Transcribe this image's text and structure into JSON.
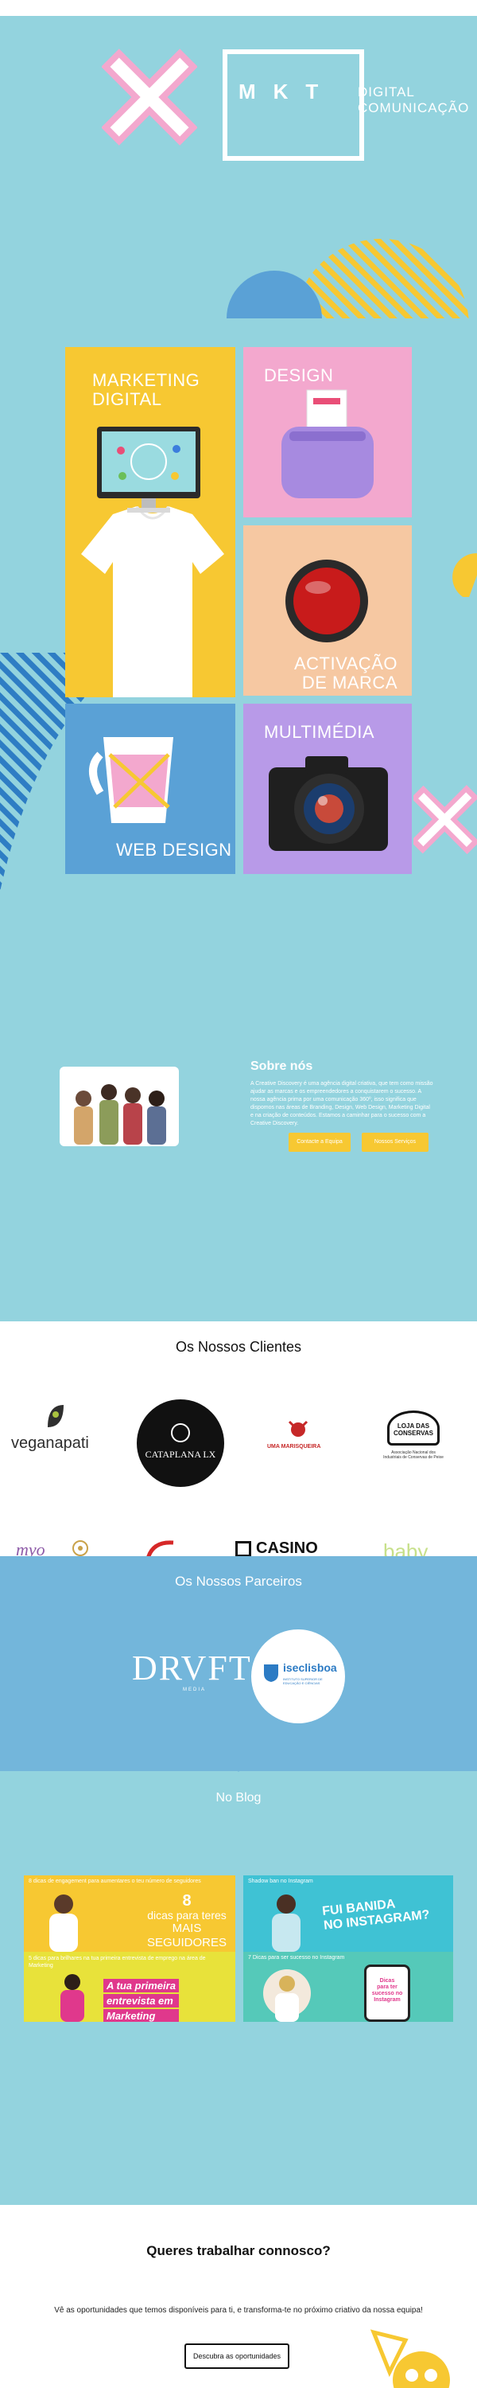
{
  "logo": {
    "mark": "MKT",
    "subtitle_line1": "DIGITAL",
    "subtitle_line2": "COMUNICAÇÃO"
  },
  "services": [
    {
      "title_line1": "MARKETING",
      "title_line2": "DIGITAL"
    },
    {
      "title_line1": "DESIGN",
      "title_line2": ""
    },
    {
      "title_line1": "ACTIVAÇÃO",
      "title_line2": "DE MARCA"
    },
    {
      "title_line1": "WEB DESIGN",
      "title_line2": ""
    },
    {
      "title_line1": "MULTIMÉDIA",
      "title_line2": ""
    }
  ],
  "about": {
    "title": "Sobre nós",
    "text": "A Creative Discovery é uma agência digital criativa, que tem como missão ajudar as marcas e os empreendedores a conquistarem o sucesso. A nossa agência prima por uma comunicação 360º, isso significa que dispomos nas áreas de Branding, Design, Web Design, Marketing Digital e na criação de conteúdos. Estamos a caminhar para o sucesso com a Creative Discovery.",
    "button_contact": "Contacte a Equipa",
    "button_services": "Nossos Serviços"
  },
  "clients": {
    "title": "Os Nossos Clientes",
    "logos": [
      "veganapati",
      "CATAPLANA LX",
      "UMA MARISQUEIRA",
      "LOJA DAS CONSERVAS"
    ],
    "logos_row2": [
      "myo",
      "",
      "CASINO",
      "baby"
    ],
    "conservas_caption": "Associação Nacional dos Industriais de Conservas de Peixe"
  },
  "partners": {
    "title": "Os Nossos Parceiros",
    "logos": [
      "DRVFT",
      "iseclisboa"
    ],
    "drvft_sub": "MEDIA",
    "isec_sub": "INSTITUTO SUPERIOR DE EDUCAÇÃO E CIÊNCIAS"
  },
  "blog": {
    "title": "No Blog",
    "posts": [
      {
        "caption": "8 dicas de engagement para aumentares o teu número de seguidores",
        "headline_line1": "8",
        "headline_line2": "dicas para teres",
        "headline_line3": "MAIS SEGUIDORES"
      },
      {
        "caption": "Shadow ban no Instagram",
        "headline_line1": "FUI BANIDA",
        "headline_line2": "NO INSTAGRAM?",
        "headline_line3": ""
      },
      {
        "caption": "5 dicas para brilhares na tua primeira entrevista de emprego na área de Marketing",
        "headline_line1": "A tua primeira",
        "headline_line2": "entrevista em",
        "headline_line3": "Marketing"
      },
      {
        "caption": "7 Dicas para ser sucesso no Instagram",
        "headline_line1": "Dicas",
        "headline_line2": "para ter",
        "headline_line3": "sucesso no Instagram"
      }
    ]
  },
  "careers": {
    "title": "Queres trabalhar connosco?",
    "text": "Vê as oportunidades que temos disponíveis para ti, e transforma-te no próximo criativo da nossa equipa!",
    "button": "Descubra as oportunidades"
  },
  "colors": {
    "background": "#93d3de",
    "yellow": "#f7c832",
    "pink": "#f3a8ce",
    "peach": "#f6c8a2",
    "blue": "#5aa1d6",
    "purple": "#b89ae8",
    "partners_bg": "#73b6db"
  }
}
